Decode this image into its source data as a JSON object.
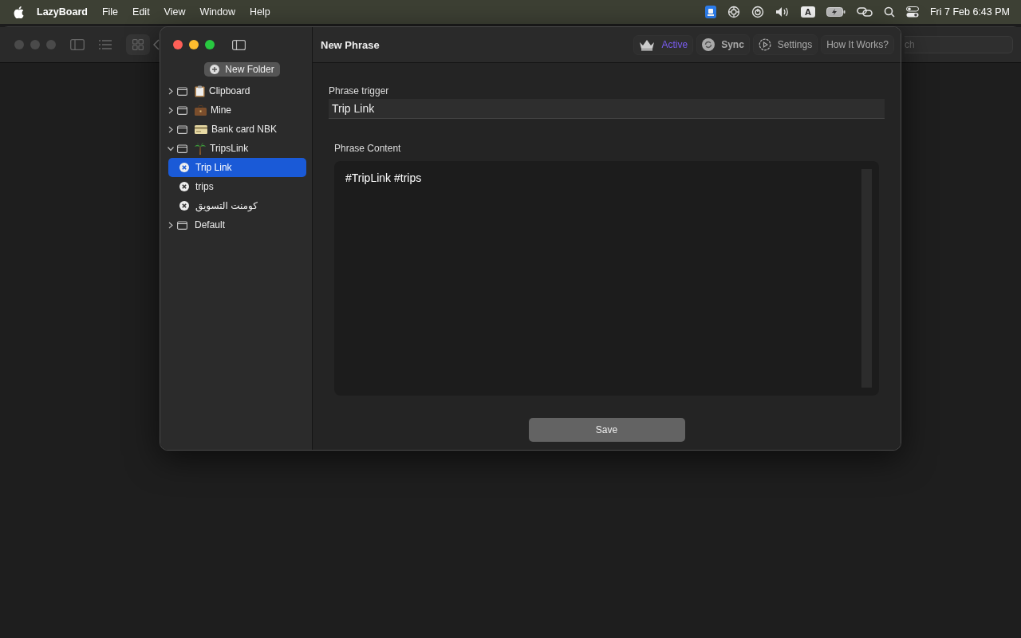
{
  "menu_bar": {
    "app": "LazyBoard",
    "menus": [
      "File",
      "Edit",
      "View",
      "Window",
      "Help"
    ],
    "input_source": "A",
    "clock": "Fri 7 Feb  6:43 PM"
  },
  "background_window": {
    "search_text": "ch"
  },
  "window": {
    "new_folder_button": "New Folder",
    "title": "New Phrase",
    "toolbar": [
      {
        "kind": "status",
        "label": "Active",
        "on": true
      },
      {
        "kind": "sync",
        "label": "Sync",
        "on": false
      },
      {
        "kind": "settings",
        "label": "Settings",
        "on": false
      },
      {
        "kind": "help",
        "label": "How It Works?",
        "on": false
      }
    ],
    "tree": [
      {
        "label": "Clipboard",
        "kind": "clipboard",
        "expanded": false
      },
      {
        "label": "Mine",
        "kind": "briefcase",
        "expanded": false
      },
      {
        "label": "Bank card NBK",
        "kind": "card",
        "expanded": false
      },
      {
        "label": "TripsLink",
        "kind": "palm",
        "expanded": true,
        "children": [
          {
            "label": "Trip Link",
            "selected": true
          },
          {
            "label": "trips",
            "selected": false
          },
          {
            "label": "كومنت التسويق",
            "selected": false
          }
        ]
      },
      {
        "label": "Default",
        "expanded": false
      }
    ],
    "trigger": {
      "label": "Phrase trigger",
      "value": "Trip Link"
    },
    "content": {
      "label": "Phrase Content",
      "value": "#TripLink #trips"
    },
    "save_button": "Save"
  }
}
